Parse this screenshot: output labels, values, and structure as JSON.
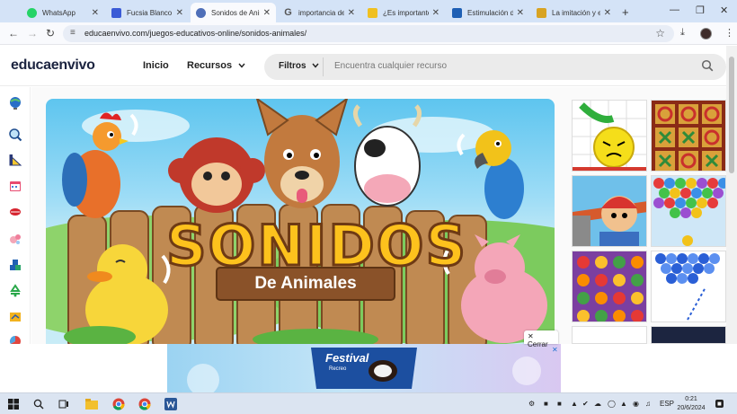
{
  "browser": {
    "tabs": [
      {
        "title": "WhatsApp",
        "active": false,
        "favicon_color": "#25d366"
      },
      {
        "title": "Fucsia Blanco M",
        "active": false,
        "favicon_color": "#3b5bd6"
      },
      {
        "title": "Sonidos de Anim",
        "active": true,
        "favicon_color": "#4f6fb8"
      },
      {
        "title": "importancia de",
        "active": false,
        "favicon_color": "#6b8fd6"
      },
      {
        "title": "¿Es importante",
        "active": false,
        "favicon_color": "#f0c020"
      },
      {
        "title": "Estimulación de",
        "active": false,
        "favicon_color": "#1e5fb4"
      },
      {
        "title": "La imitación y el",
        "active": false,
        "favicon_color": "#d8a322"
      }
    ],
    "close_glyph": "✕",
    "new_tab_glyph": "+",
    "url": "educaenvivo.com/juegos-educativos-online/sonidos-animales/"
  },
  "site": {
    "logo": "educaenvivo",
    "nav": {
      "inicio": "Inicio",
      "recursos": "Recursos"
    },
    "search": {
      "filters_label": "Filtros",
      "placeholder": "Encuentra cualquier recurso"
    }
  },
  "hero": {
    "title": "SONIDOS",
    "subtitle": "De Animales"
  },
  "rail_icons": [
    "globe-icon",
    "magnifier-icon",
    "ruler-icon",
    "calendar-icon",
    "lips-icon",
    "bubbles-icon",
    "blocks-icon",
    "recycle-icon",
    "notebook-icon",
    "chart-icon"
  ],
  "thumbnails": [
    "angry-ball-game",
    "tic-tac-toe-game",
    "runner-game",
    "bubble-shooter-game",
    "fruit-match-game",
    "bubble-pop-game",
    "coloring-game",
    "dark-game"
  ],
  "ad": {
    "close_label": "Cerrar",
    "brand": "Festival",
    "brand_sub": "Recreo"
  },
  "taskbar": {
    "lang": "ESP",
    "time": "0:21",
    "date": "20/6/2024"
  },
  "colors": {
    "accent_blue": "#1a73e8",
    "hero_sky": "#5ec5ef",
    "title_yellow": "#fdc21d",
    "title_outline": "#6e3a14"
  }
}
